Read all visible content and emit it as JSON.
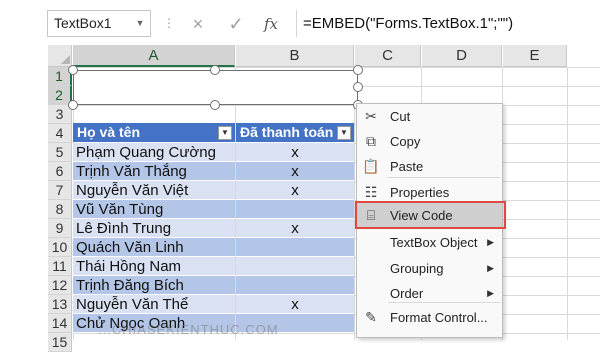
{
  "formula_bar": {
    "name_box": "TextBox1",
    "name_box_arrow": "▼",
    "separator": "⋮",
    "cancel_icon": "×",
    "enter_icon": "✓",
    "fx_label": "fx",
    "formula": "=EMBED(\"Forms.TextBox.1\";\"\")"
  },
  "columns": [
    {
      "label": "A",
      "selected": true
    },
    {
      "label": "B",
      "selected": false
    },
    {
      "label": "C",
      "selected": false
    },
    {
      "label": "D",
      "selected": false
    },
    {
      "label": "E",
      "selected": false
    }
  ],
  "rows": [
    "1",
    "2",
    "3",
    "4",
    "5",
    "6",
    "7",
    "8",
    "9",
    "10",
    "11",
    "12",
    "13",
    "14",
    "15"
  ],
  "selected_rows": [
    "1",
    "2"
  ],
  "table": {
    "header_name": "Họ và tên",
    "header_paid": "Đã thanh toán",
    "filter_icon": "▼",
    "records": [
      {
        "name": "Phạm Quang Cường",
        "paid": "x"
      },
      {
        "name": "Trịnh Văn Thắng",
        "paid": "x"
      },
      {
        "name": "Nguyễn Văn Việt",
        "paid": "x"
      },
      {
        "name": "Vũ Văn Tùng",
        "paid": ""
      },
      {
        "name": "Lê Đình Trung",
        "paid": "x"
      },
      {
        "name": "Quách Văn Linh",
        "paid": ""
      },
      {
        "name": "Thái Hồng Nam",
        "paid": ""
      },
      {
        "name": "Trịnh Đăng Bích",
        "paid": ""
      },
      {
        "name": "Nguyễn Văn Thể",
        "paid": "x"
      },
      {
        "name": "Chử Ngọc Oanh",
        "paid": ""
      }
    ]
  },
  "context_menu": {
    "items": [
      {
        "label": "Cut",
        "icon": "scissors-icon",
        "glyph": "✂",
        "submenu": false
      },
      {
        "label": "Copy",
        "icon": "copy-icon",
        "glyph": "⧉",
        "submenu": false
      },
      {
        "label": "Paste",
        "icon": "paste-icon",
        "glyph": "📋",
        "submenu": false
      },
      {
        "label": "Properties",
        "icon": "properties-icon",
        "glyph": "☷",
        "submenu": false
      },
      {
        "label": "View Code",
        "icon": "view-code-icon",
        "glyph": "⌸",
        "submenu": false,
        "highlighted": true
      },
      {
        "label": "TextBox Object",
        "icon": "",
        "glyph": "",
        "submenu": true
      },
      {
        "label": "Grouping",
        "icon": "",
        "glyph": "",
        "submenu": true
      },
      {
        "label": "Order",
        "icon": "",
        "glyph": "",
        "submenu": true
      },
      {
        "label": "Format Control...",
        "icon": "format-control-icon",
        "glyph": "✎",
        "submenu": false
      }
    ],
    "submenu_arrow": "▶"
  },
  "colors": {
    "table_header": "#4472c4",
    "row_band_light": "#d9e1f2",
    "row_band_dark": "#b4c6e7",
    "selection_green": "#217346",
    "highlight_border": "#e0493e"
  },
  "watermark": "...CHIASEKIENTHUC.COM"
}
